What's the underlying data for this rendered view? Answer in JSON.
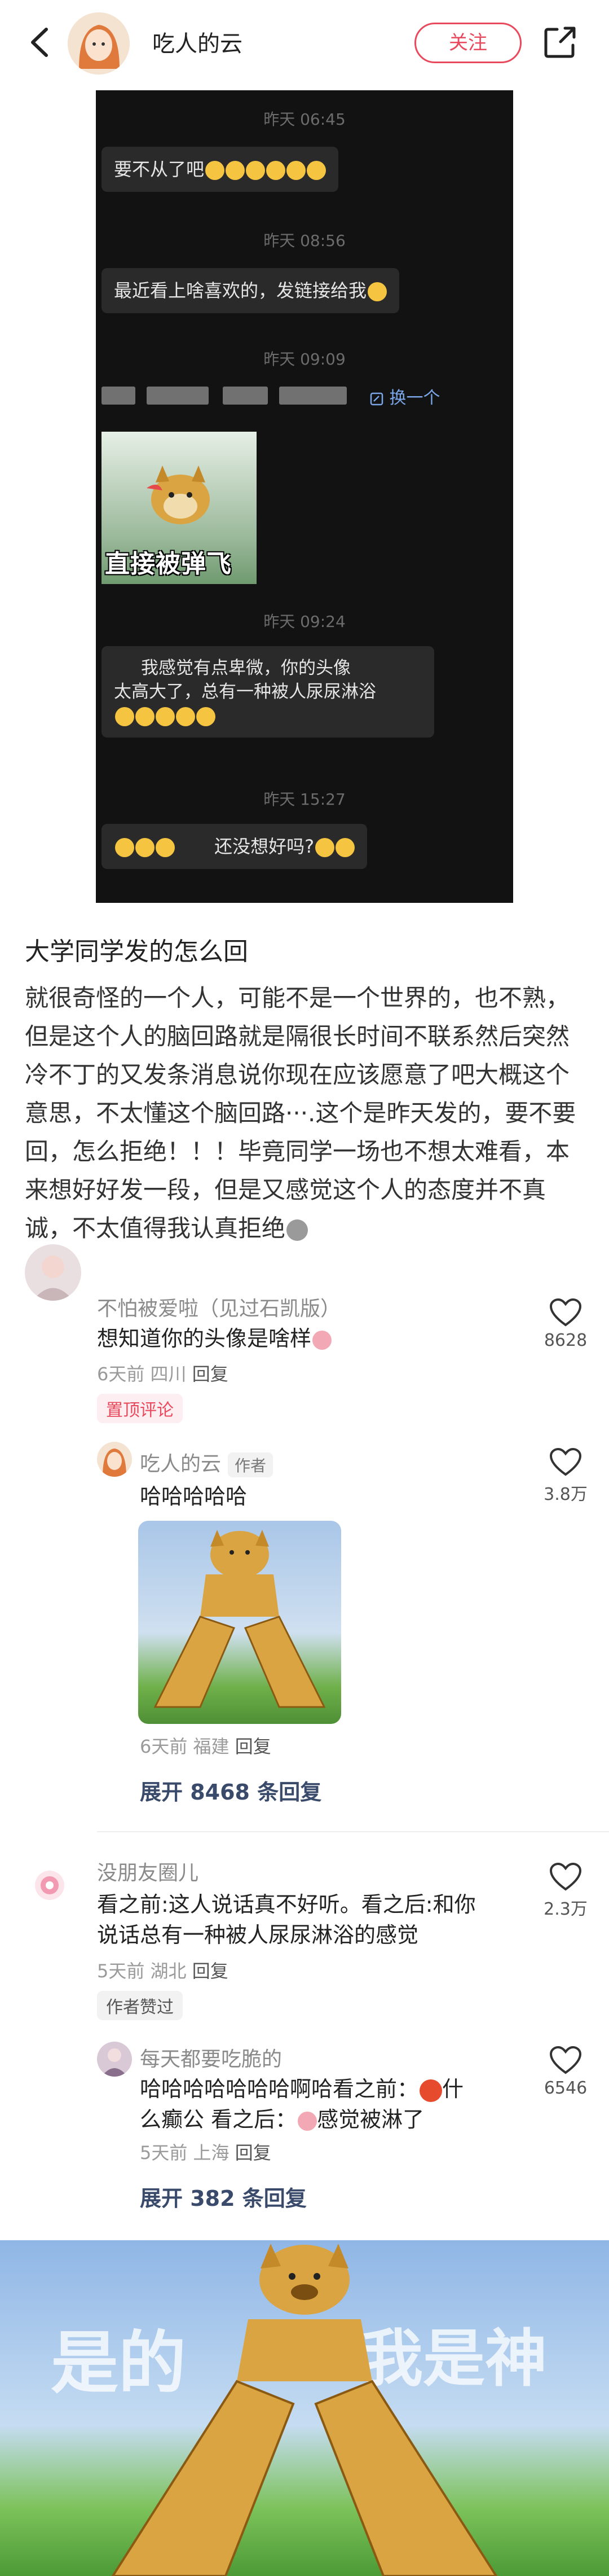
{
  "header": {
    "author_name": "吃人的云",
    "follow_label": "关注"
  },
  "screenshot": {
    "messages": [
      {
        "time": "昨天 06:45",
        "text": "要不从了吧"
      },
      {
        "time": "昨天 08:56",
        "text": "最近看上啥喜欢的，发链接给我"
      },
      {
        "time": "昨天 09:09",
        "swap_label": "换一个",
        "sticker_caption": "直接被弹飞"
      },
      {
        "time": "昨天 09:24",
        "text_line1": "我感觉有点卑微，你的头像",
        "text_line2": "太高大了，总有一种被人尿尿淋浴"
      },
      {
        "time": "昨天 15:27",
        "text": "还没想好吗?"
      }
    ]
  },
  "post": {
    "title": "大学同学发的怎么回",
    "body": "就很奇怪的一个人，可能不是一个世界的，也不熟，但是这个人的脑回路就是隔很长时间不联系然后突然冷不丁的又发条消息说你现在应该愿意了吧大概这个意思，不太懂这个脑回路···.这个是昨天发的，要不要回，怎么拒绝！！！毕竟同学一场也不想太难看，本来想好好发一段，但是又感觉这个人的态度并不真诚，不太值得我认真拒绝"
  },
  "comments": [
    {
      "name": "不怕被爱啦（见过石凯版）",
      "text": "想知道你的头像是啥样",
      "time": "6天前",
      "location": "四川",
      "reply": "回复",
      "likes": "8628",
      "tag": "置顶评论",
      "replies": [
        {
          "name": "吃人的云",
          "badge": "作者",
          "text": "哈哈哈哈哈",
          "time": "6天前",
          "location": "福建",
          "reply": "回复",
          "likes": "3.8万"
        }
      ],
      "expand": "展开 8468 条回复"
    },
    {
      "name": "没朋友圈儿",
      "text_line1": "看之前:这人说话真不好听。看之后:和你",
      "text_line2": "说话总有一种被人尿尿淋浴的感觉",
      "time": "5天前",
      "location": "湖北",
      "reply": "回复",
      "likes": "2.3万",
      "tag": "作者赞过",
      "replies": [
        {
          "name": "每天都要吃脆的",
          "text_line1": "哈哈哈哈哈哈哈啊哈看之前：",
          "text_line1_tail": "什",
          "text_line2": "么癫公   看之后：",
          "text_line2_tail": "感觉被淋了",
          "time": "5天前",
          "location": "上海",
          "reply": "回复",
          "likes": "6546"
        }
      ],
      "expand": "展开 382 条回复"
    }
  ],
  "bottom_image": {
    "left_text": "是的",
    "right_text": "我是神"
  },
  "colors": {
    "accent": "#e8495c",
    "expand": "#3a4a6b"
  }
}
